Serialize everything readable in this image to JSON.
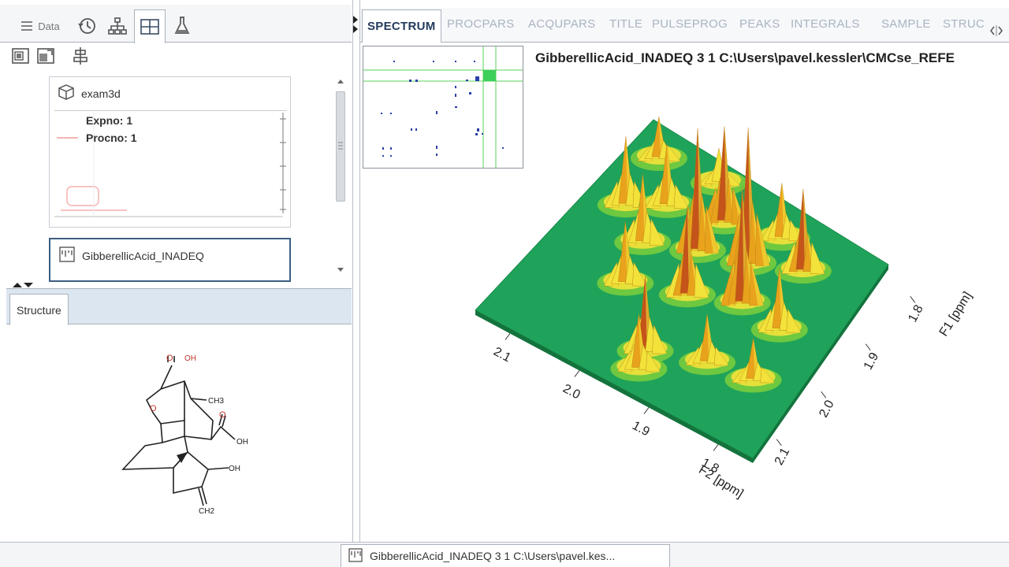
{
  "left_tabs": {
    "data_label": "Data",
    "icons": [
      "list-icon",
      "history-icon",
      "tree-icon",
      "layout-icon",
      "flask-icon"
    ]
  },
  "left_toolbar": {
    "icons": [
      "window-icon",
      "window-edit-icon",
      "align-icon"
    ]
  },
  "thumbnails": [
    {
      "name": "exam3d",
      "icon": "cube-icon",
      "legend": [
        "Expno: 1",
        "Procno: 1"
      ]
    },
    {
      "name": "GibberellicAcid_INADEQ",
      "icon": "spectrum-icon"
    }
  ],
  "structure_panel": {
    "tab_label": "Structure",
    "labels": {
      "oh_top": "OH",
      "ch3": "CH3",
      "oh_acid": "OH",
      "oh_ring": "OH",
      "ch2": "CH2",
      "o_top": "O",
      "o_acid": "O",
      "o_ring": "O"
    }
  },
  "right_tabs": [
    {
      "label": "SPECTRUM",
      "active": true
    },
    {
      "label": "PROCPARS",
      "active": false
    },
    {
      "label": "ACQUPARS",
      "active": false
    },
    {
      "label": "TITLE",
      "active": false
    },
    {
      "label": "PULSEPROG",
      "active": false
    },
    {
      "label": "PEAKS",
      "active": false
    },
    {
      "label": "INTEGRALS",
      "active": false
    },
    {
      "label": "SAMPLE",
      "active": false
    },
    {
      "label": "STRUC",
      "active": false
    }
  ],
  "spectrum": {
    "title": "GibberellicAcid_INADEQ  3  1  C:\\Users\\pavel.kessler\\CMCse_REFE",
    "plane_color": "#1fa35a",
    "peak_colors": [
      "#f2e23a",
      "#e8a21c",
      "#c4541a"
    ]
  },
  "chart_data": {
    "type": "surface3d",
    "x_axis": {
      "label": "F2 [ppm]",
      "ticks": [
        "2.1",
        "2.0",
        "1.9",
        "1.8"
      ]
    },
    "y_axis": {
      "label": "F1 [ppm]",
      "ticks": [
        "2.1",
        "2.0",
        "1.9",
        "1.8"
      ]
    },
    "xlim": [
      2.15,
      1.75
    ],
    "ylim": [
      2.15,
      1.75
    ],
    "peaks": [
      {
        "x": 1.95,
        "y": 2.08,
        "h": 0.55
      },
      {
        "x": 1.88,
        "y": 2.05,
        "h": 0.35
      },
      {
        "x": 2.03,
        "y": 2.0,
        "h": 0.45
      },
      {
        "x": 1.96,
        "y": 1.97,
        "h": 0.65
      },
      {
        "x": 1.9,
        "y": 1.94,
        "h": 0.85
      },
      {
        "x": 2.05,
        "y": 1.93,
        "h": 0.5
      },
      {
        "x": 1.99,
        "y": 1.9,
        "h": 0.9
      },
      {
        "x": 1.93,
        "y": 1.88,
        "h": 1.0
      },
      {
        "x": 2.1,
        "y": 1.89,
        "h": 0.5
      },
      {
        "x": 2.06,
        "y": 1.86,
        "h": 0.45
      },
      {
        "x": 1.99,
        "y": 1.84,
        "h": 0.7
      },
      {
        "x": 1.92,
        "y": 1.82,
        "h": 0.4
      },
      {
        "x": 2.11,
        "y": 1.8,
        "h": 0.3
      },
      {
        "x": 2.03,
        "y": 1.79,
        "h": 0.25
      },
      {
        "x": 1.87,
        "y": 1.85,
        "h": 0.6
      },
      {
        "x": 1.84,
        "y": 1.95,
        "h": 0.45
      },
      {
        "x": 1.94,
        "y": 2.11,
        "h": 0.4
      },
      {
        "x": 1.82,
        "y": 2.04,
        "h": 0.3
      }
    ]
  },
  "status": {
    "text": "GibberellicAcid_INADEQ  3  1  C:\\Users\\pavel.kes..."
  }
}
